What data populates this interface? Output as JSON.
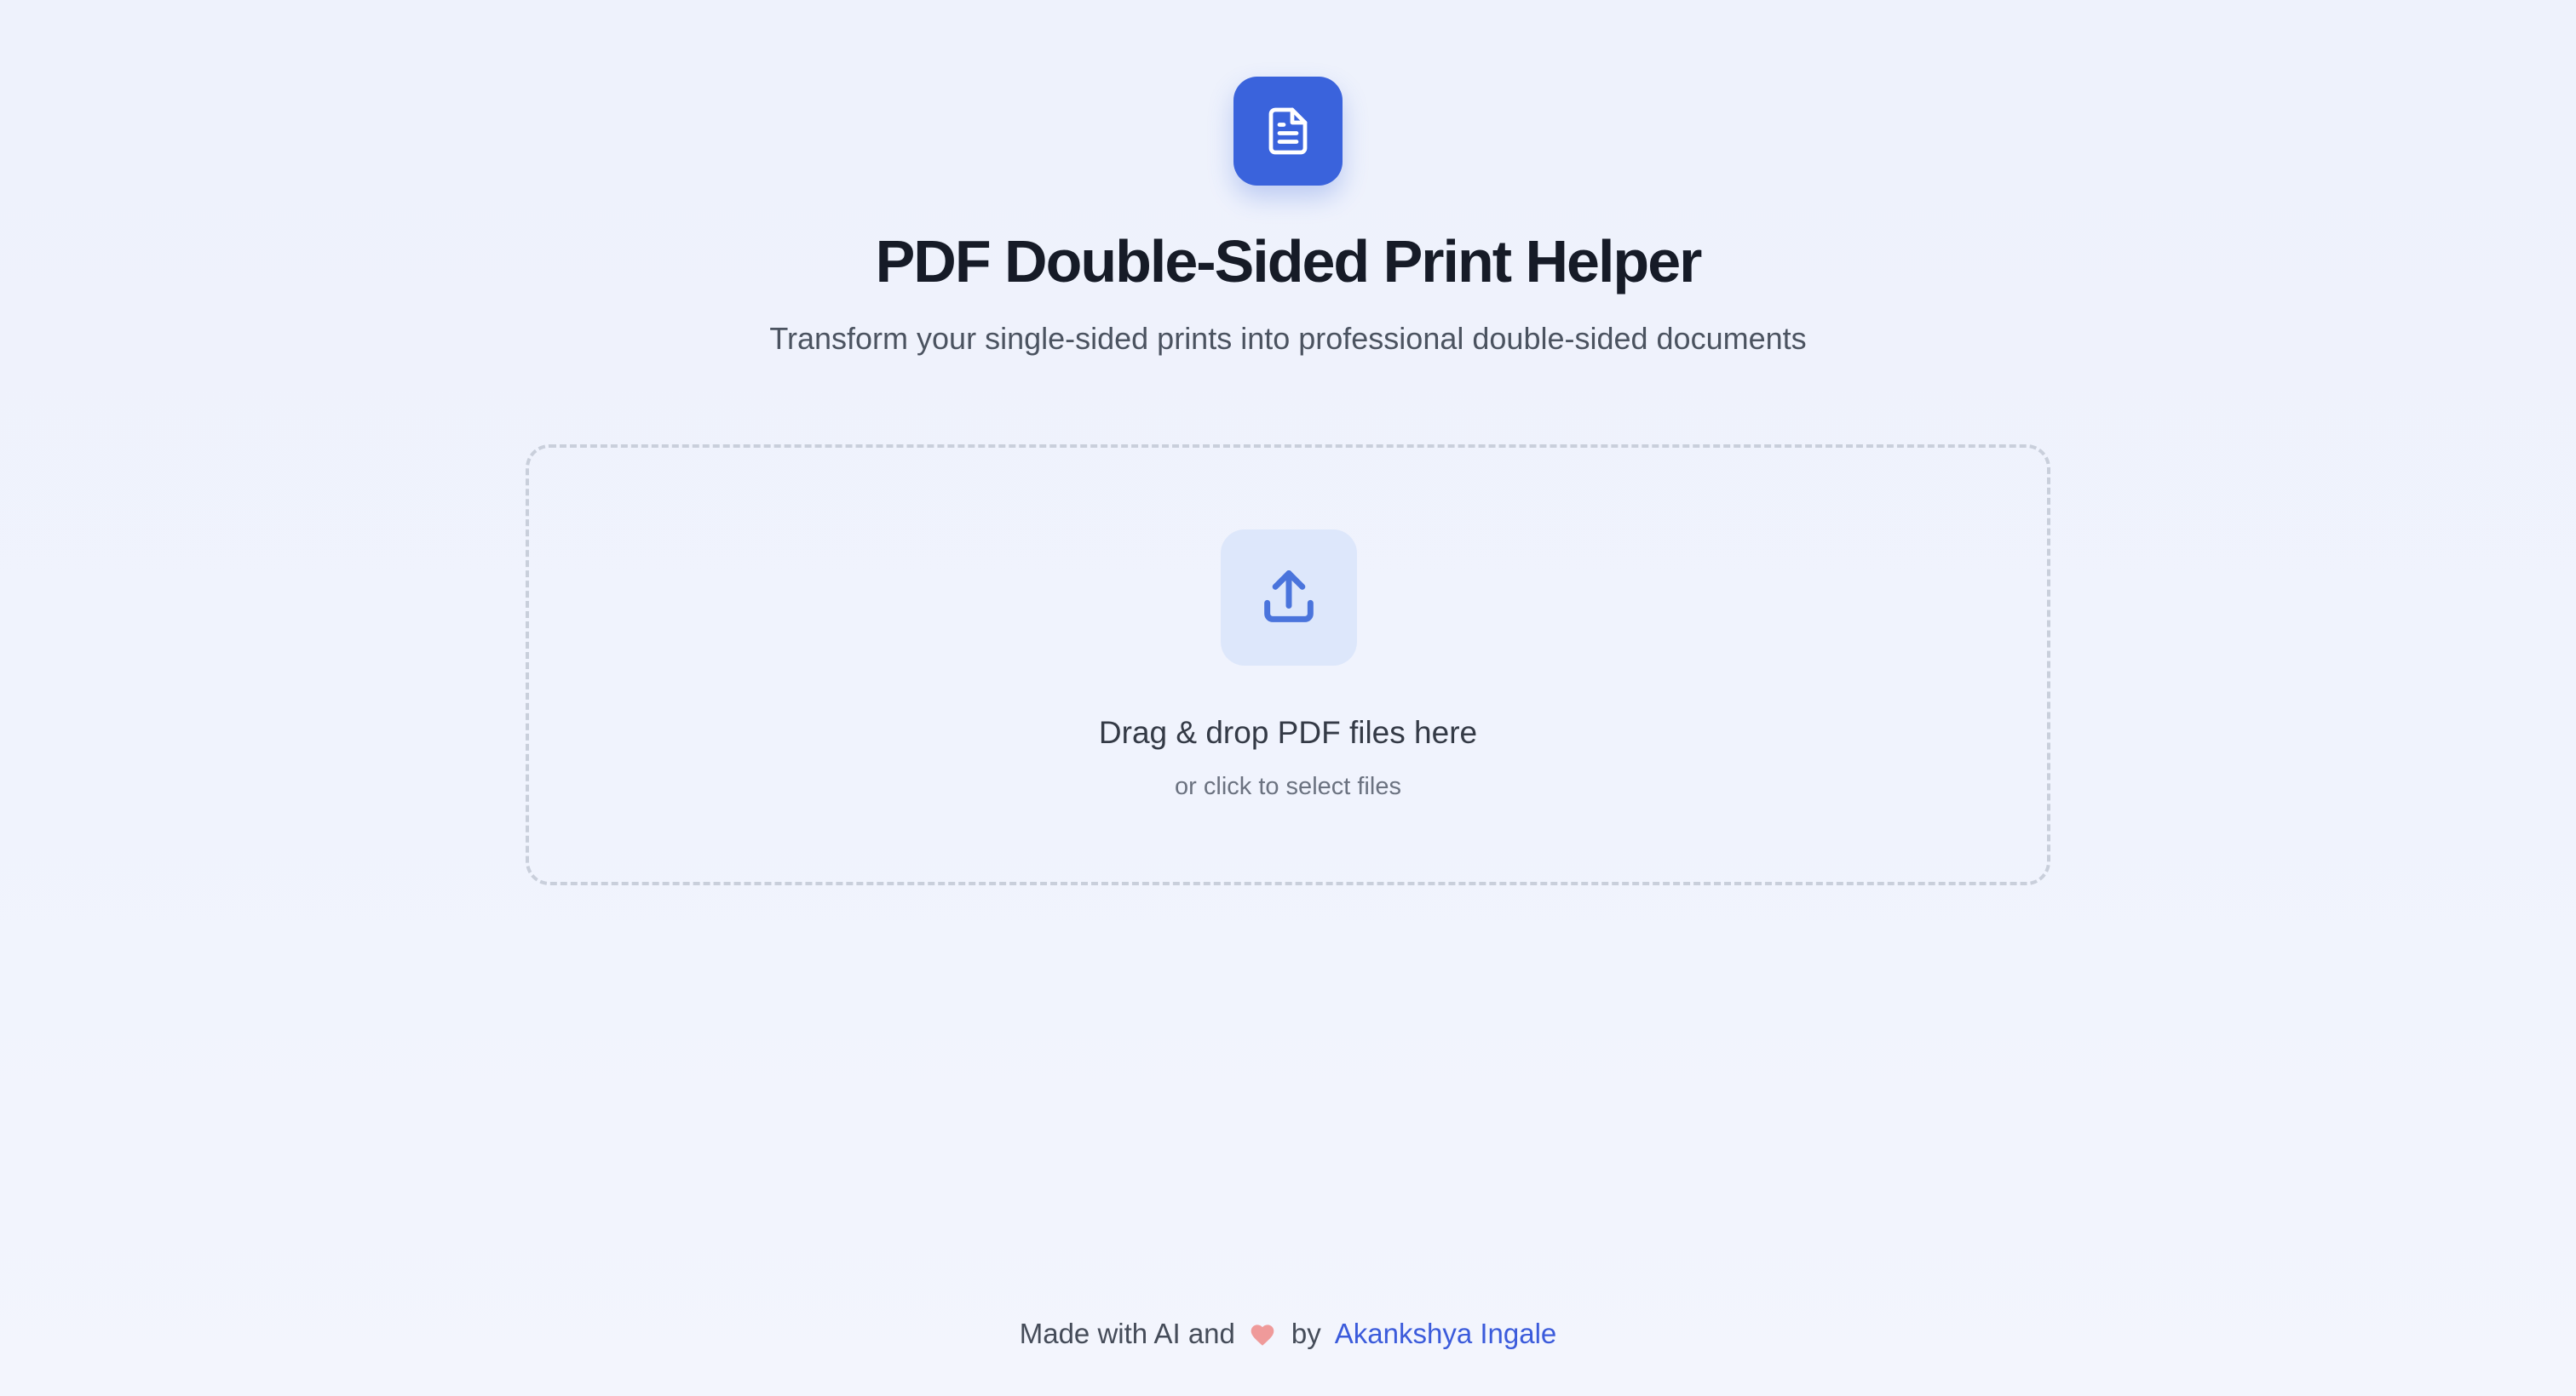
{
  "header": {
    "logo_icon": "document-icon",
    "title": "PDF Double-Sided Print Helper",
    "subtitle": "Transform your single-sided prints into professional double-sided documents"
  },
  "dropzone": {
    "icon": "upload-icon",
    "title": "Drag & drop PDF files here",
    "hint": "or click to select files"
  },
  "footer": {
    "prefix": "Made with AI and",
    "heart_icon": "heart-icon",
    "by": "by",
    "author": "Akankshya Ingale"
  },
  "colors": {
    "accent": "#3a63dc",
    "link": "#3b5bdb",
    "upload_box_bg": "#dde7fb",
    "heart": "#ef9a9a",
    "background": "#eef2fc"
  }
}
